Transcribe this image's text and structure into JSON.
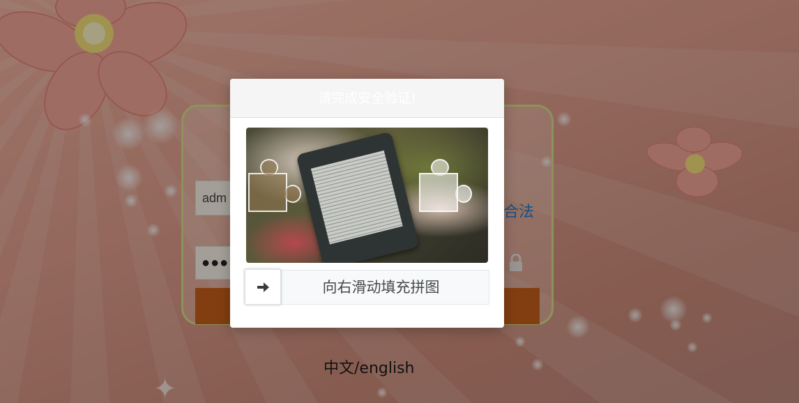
{
  "login": {
    "username_value": "adm",
    "password_value": "●●●●",
    "valid_link": "合法"
  },
  "captcha": {
    "title": "请完成安全验证!",
    "slider_hint": "向右滑动填充拼图",
    "handle_icon": "arrow-right-icon"
  },
  "footer": {
    "lang_switch": "中文/english"
  },
  "colors": {
    "login_button": "#c8601a",
    "link": "#2a7bc6",
    "card_border": "#d9e08a"
  }
}
